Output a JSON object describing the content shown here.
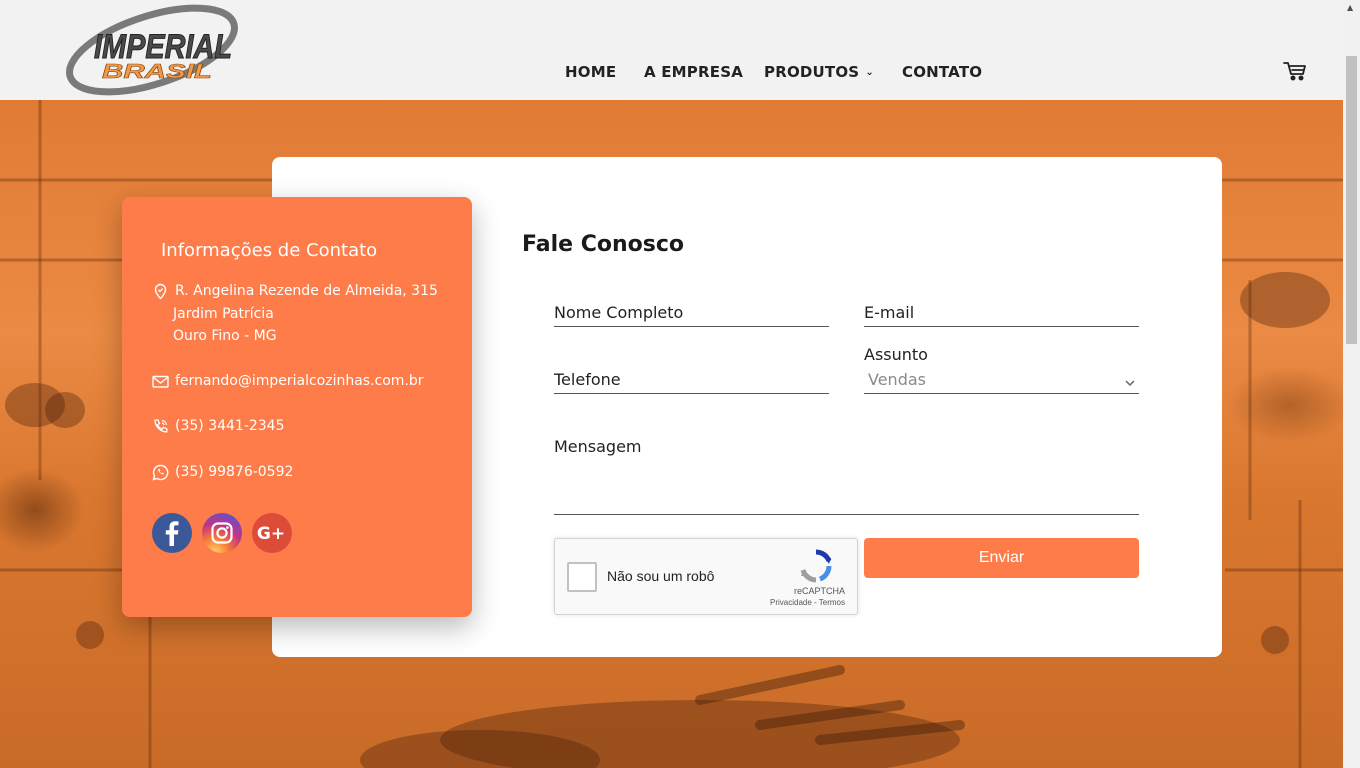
{
  "header": {
    "logo": {
      "line1": "IMPERIAL",
      "line2": "BRASIL"
    },
    "nav": [
      {
        "label": "HOME"
      },
      {
        "label": "A EMPRESA"
      },
      {
        "label": "PRODUTOS",
        "has_dropdown": true
      },
      {
        "label": "CONTATO"
      }
    ],
    "cart_icon": "shopping-cart-icon"
  },
  "contact_card": {
    "title": "Informações de Contato",
    "address": {
      "line1": "R. Angelina Rezende de Almeida, 315",
      "line2": "Jardim Patrícia",
      "line3": "Ouro Fino - MG",
      "icon": "location-pin-icon"
    },
    "email": {
      "value": "fernando@imperialcozinhas.com.br",
      "icon": "mail-icon"
    },
    "phone": {
      "value": "(35) 3441-2345",
      "icon": "phone-icon"
    },
    "whatsapp": {
      "value": "(35) 99876-0592",
      "icon": "whatsapp-icon"
    },
    "social": [
      {
        "name": "facebook",
        "icon": "facebook-icon",
        "color": "#3b5998"
      },
      {
        "name": "instagram",
        "icon": "instagram-icon",
        "color": "#c13584"
      },
      {
        "name": "google-plus",
        "icon": "google-plus-icon",
        "color": "#dd4b39"
      }
    ],
    "color": "#fd7c4a"
  },
  "form": {
    "title": "Fale Conosco",
    "fields": {
      "name": "Nome Completo",
      "email": "E-mail",
      "phone": "Telefone",
      "subject_label": "Assunto",
      "subject_value": "Vendas",
      "message": "Mensagem"
    },
    "recaptcha": {
      "checkbox_label": "Não sou um robô",
      "brand": "reCAPTCHA",
      "privacy": "Privacidade",
      "separator": " - ",
      "terms": "Termos"
    },
    "submit_label": "Enviar"
  },
  "colors": {
    "accent": "#fd7c4a",
    "header_bg": "#f2f2f2"
  }
}
